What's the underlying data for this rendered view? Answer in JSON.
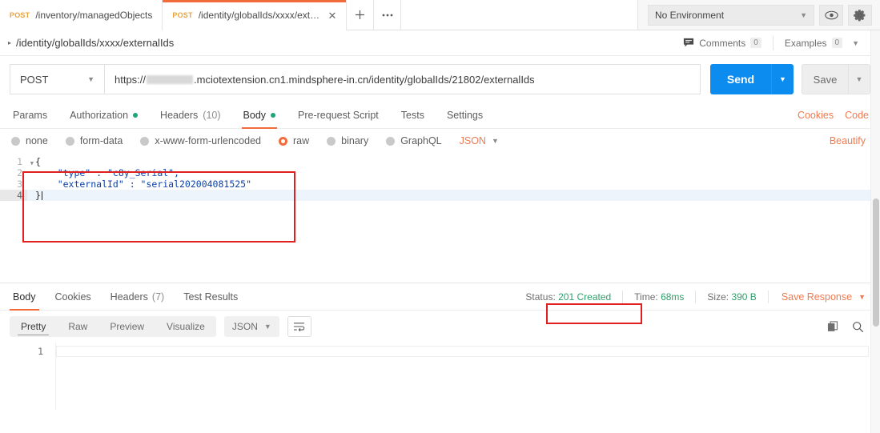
{
  "tabbar": {
    "tabs": [
      {
        "method": "POST",
        "label": "/inventory/managedObjects",
        "active": false,
        "closable": false
      },
      {
        "method": "POST",
        "label": "/identity/globalIds/xxxx/exter...",
        "active": true,
        "closable": true
      }
    ],
    "new_tab_label": "+",
    "more_label": "•••",
    "environment": "No Environment",
    "environment_caret": "▼",
    "eye_icon": "eye-icon",
    "settings_icon": "gear-icon"
  },
  "namebar": {
    "expand_caret": "▸",
    "request_name": "/identity/globalIds/xxxx/externalIds",
    "comments_label": "Comments",
    "comments_count": "0",
    "examples_label": "Examples",
    "examples_count": "0",
    "examples_caret": "▼"
  },
  "urlbar": {
    "method": "POST",
    "method_caret": "▼",
    "url_prefix": "https://",
    "url_suffix": ".mciotextension.cn1.mindsphere-in.cn/identity/globalIds/21802/externalIds",
    "send_label": "Send",
    "send_caret": "▼",
    "save_label": "Save",
    "save_caret": "▼"
  },
  "request_tabs": {
    "items": [
      {
        "label": "Params",
        "badge": "",
        "dot": false,
        "active": false
      },
      {
        "label": "Authorization",
        "badge": "",
        "dot": true,
        "active": false
      },
      {
        "label": "Headers",
        "badge": "(10)",
        "dot": false,
        "active": false
      },
      {
        "label": "Body",
        "badge": "",
        "dot": true,
        "active": true
      },
      {
        "label": "Pre-request Script",
        "badge": "",
        "dot": false,
        "active": false
      },
      {
        "label": "Tests",
        "badge": "",
        "dot": false,
        "active": false
      },
      {
        "label": "Settings",
        "badge": "",
        "dot": false,
        "active": false
      }
    ],
    "cookies_label": "Cookies",
    "code_label": "Code"
  },
  "body_types": {
    "options": [
      {
        "label": "none",
        "selected": false
      },
      {
        "label": "form-data",
        "selected": false
      },
      {
        "label": "x-www-form-urlencoded",
        "selected": false
      },
      {
        "label": "raw",
        "selected": true
      },
      {
        "label": "binary",
        "selected": false
      },
      {
        "label": "GraphQL",
        "selected": false
      }
    ],
    "format": "JSON",
    "format_caret": "▼",
    "beautify_label": "Beautify"
  },
  "editor": {
    "lines": [
      {
        "number": "1",
        "text": "{",
        "fold": true
      },
      {
        "number": "2",
        "text": "    \"type\" : \"c8y_Serial\",",
        "fold": false
      },
      {
        "number": "3",
        "text": "    \"externalId\" : \"serial202004081525\"",
        "fold": false
      },
      {
        "number": "4",
        "text": "}",
        "fold": false,
        "cursor": true
      }
    ]
  },
  "response": {
    "tabs": [
      {
        "label": "Body",
        "badge": "",
        "active": true
      },
      {
        "label": "Cookies",
        "badge": "",
        "active": false
      },
      {
        "label": "Headers",
        "badge": "(7)",
        "active": false
      },
      {
        "label": "Test Results",
        "badge": "",
        "active": false
      }
    ],
    "status_label": "Status:",
    "status_value": "201 Created",
    "time_label": "Time:",
    "time_value": "68ms",
    "size_label": "Size:",
    "size_value": "390 B",
    "save_response_label": "Save Response",
    "save_response_caret": "▼",
    "view_modes": [
      {
        "label": "Pretty",
        "active": true
      },
      {
        "label": "Raw",
        "active": false
      },
      {
        "label": "Preview",
        "active": false
      },
      {
        "label": "Visualize",
        "active": false
      }
    ],
    "format": "JSON",
    "format_caret": "▼",
    "wrap_icon": "word-wrap-icon",
    "copy_icon": "copy-icon",
    "search_icon": "search-icon",
    "body_lines": [
      {
        "number": "1",
        "text": ""
      }
    ]
  },
  "annotations": {
    "body_box_color": "#e02020",
    "status_box_color": "#e02020"
  },
  "colors": {
    "accent_orange": "#f26b3a",
    "send_blue": "#0d8cf0",
    "status_green": "#2fa06a",
    "method_amber": "#e8a33d",
    "link_orange": "#ef7b52"
  }
}
